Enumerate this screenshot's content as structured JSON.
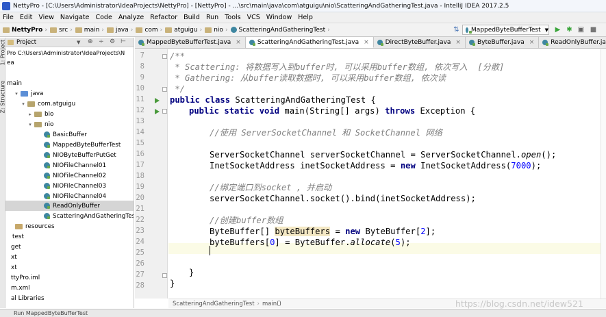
{
  "window": {
    "title": "NettyPro - [C:\\Users\\Administrator\\IdeaProjects\\NettyPro] - [NettyPro] - ...\\src\\main\\java\\com\\atguigu\\nio\\ScatteringAndGatheringTest.java - IntelliJ IDEA 2017.2.5"
  },
  "menu": [
    "File",
    "Edit",
    "View",
    "Navigate",
    "Code",
    "Analyze",
    "Refactor",
    "Build",
    "Run",
    "Tools",
    "VCS",
    "Window",
    "Help"
  ],
  "breadcrumbs": [
    "NettyPro",
    "src",
    "main",
    "java",
    "com",
    "atguigu",
    "nio",
    "ScatteringAndGatheringTest"
  ],
  "run_config": "MappedByteBufferTest",
  "stripe": {
    "project": "1: Project",
    "structure": "Z: Structure"
  },
  "project_panel": {
    "header": "Project",
    "path": "Pro  C:\\Users\\Administrator\\IdeaProjects\\N",
    "items": [
      {
        "label": "ea"
      },
      {
        "label": "main"
      },
      {
        "label": "java"
      },
      {
        "label": "com.atguigu"
      },
      {
        "label": "bio"
      },
      {
        "label": "nio"
      },
      {
        "label": "BasicBuffer"
      },
      {
        "label": "MappedByteBufferTest"
      },
      {
        "label": "NIOByteBufferPutGet"
      },
      {
        "label": "NIOFileChannel01"
      },
      {
        "label": "NIOFileChannel02"
      },
      {
        "label": "NIOFileChannel03"
      },
      {
        "label": "NIOFileChannel04"
      },
      {
        "label": "ReadOnlyBuffer"
      },
      {
        "label": "ScatteringAndGatheringTest"
      },
      {
        "label": "resources"
      },
      {
        "label": "test"
      },
      {
        "label": "get"
      },
      {
        "label": "xt"
      },
      {
        "label": "xt"
      },
      {
        "label": "ttyPro.iml"
      },
      {
        "label": "m.xml"
      },
      {
        "label": "al Libraries"
      }
    ]
  },
  "tabs": [
    {
      "label": "MappedByteBufferTest.java",
      "active": false
    },
    {
      "label": "ScatteringAndGatheringTest.java",
      "active": true
    },
    {
      "label": "DirectByteBuffer.java",
      "active": false
    },
    {
      "label": "ByteBuffer.java",
      "active": false
    },
    {
      "label": "ReadOnlyBuffer.java",
      "active": false
    }
  ],
  "tab_close": "×",
  "editor": {
    "line_numbers": [
      "7",
      "8",
      "9",
      "10",
      "11",
      "12",
      "13",
      "14",
      "15",
      "16",
      "17",
      "18",
      "19",
      "20",
      "21",
      "22",
      "23",
      "24",
      "25",
      "26",
      "27",
      "28"
    ],
    "lines": {
      "l7": "/**",
      "l8": " * Scattering: 将数据写入到buffer时, 可以采用buffer数组, 依次写入  [分散]",
      "l9": " * Gathering: 从buffer读取数据时, 可以采用buffer数组, 依次读",
      "l10": " */",
      "l11_kw": "public class",
      "l11_rest": " ScatteringAndGatheringTest {",
      "l12_kw1": "public static void",
      "l12_mid": " main(String[] args) ",
      "l12_kw2": "throws",
      "l12_end": " Exception {",
      "l14": "//使用 ServerSocketChannel 和 SocketChannel 网络",
      "l16_a": "ServerSocketChannel serverSocketChannel = ServerSocketChannel.",
      "l16_b": "open",
      "l16_c": "();",
      "l17_a": "InetSocketAddress inetSocketAddress = ",
      "l17_kw": "new",
      "l17_b": " InetSocketAddress(",
      "l17_num": "7000",
      "l17_c": ");",
      "l19": "//绑定端口到socket , 并启动",
      "l20": "serverSocketChannel.socket().bind(inetSocketAddress);",
      "l22": "//创建buffer数组",
      "l23_a": "ByteBuffer[] ",
      "l23_hl": "byteBuffers",
      "l23_b": " = ",
      "l23_kw": "new",
      "l23_c": " ByteBuffer[",
      "l23_num": "2",
      "l23_d": "];",
      "l24_a": "byteBuffers[",
      "l24_num0": "0",
      "l24_b": "] = ByteBuffer.",
      "l24_it": "allocate",
      "l24_c": "(",
      "l24_num5": "5",
      "l24_d": ");",
      "l27": "}",
      "l28": "}"
    }
  },
  "editor_breadcrumb": [
    "ScatteringAndGatheringTest",
    "main()"
  ],
  "watermark": "https://blog.csdn.net/idew521",
  "bottom_tool": "Run   MappedByteBufferTest"
}
